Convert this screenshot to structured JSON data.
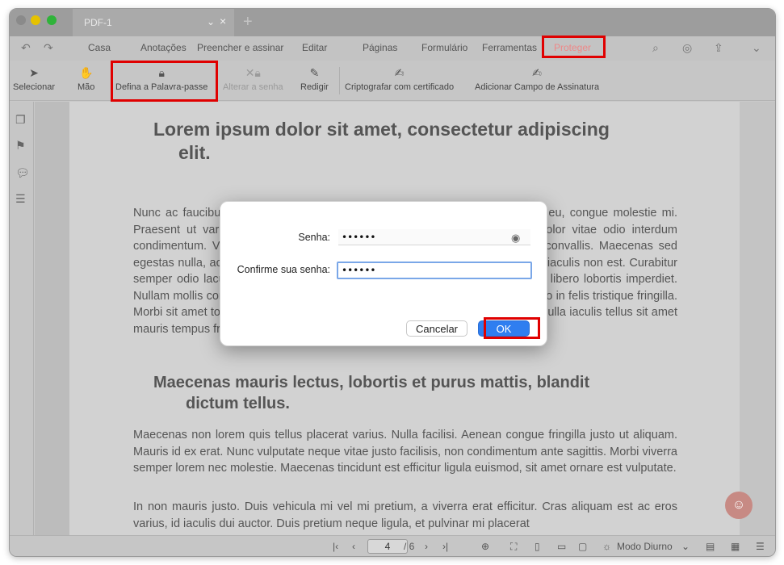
{
  "tab": {
    "title": "PDF-1"
  },
  "menu": {
    "items": [
      "Casa",
      "Anotações",
      "Preencher e assinar",
      "Editar",
      "Páginas",
      "Formulário",
      "Ferramentas",
      "Proteger"
    ]
  },
  "toolbar": {
    "select": "Selecionar",
    "hand": "Mão",
    "set_password": "Defina a Palavra-passe",
    "change_password": "Alterar a senha",
    "redact": "Redigir",
    "encrypt_cert": "Criptografar com certificado",
    "add_signature_field": "Adicionar Campo de Assinatura"
  },
  "document": {
    "heading1_line1": "Lorem ipsum dolor sit amet, consectetur adipiscing",
    "heading1_line2": "elit.",
    "para1": "Nunc ac faucibus odio. Vestibulum neque massa, scelerisque sit amet ligula eu, congue molestie mi. Praesent ut varius sem. Nullam at porttitor arcu, nec lacinia nisi. Ut ac dolor vitae odio interdum condimentum. Vivamus dapibus sodales ex, vitae malesuada ipsum cursus convallis. Maecenas sed egestas nulla, ac condimentum orci. Mauris diam felis, vulputate ac suscipit et, iaculis non est. Curabitur semper odio lacus, vel semper, nec luctus nisl blandit. Integer lacinia ante ac libero lobortis imperdiet. Nullam mollis convallis ipsum, ac accumsan nunc vehicula vitae. Nulla eget justo in felis tristique fringilla. Morbi sit amet tortor quis risus auctor condimentum. Morbi in ullamcorper elit. Nulla iaculis tellus sit amet mauris tempus fringilla.",
    "heading2_line1": "Maecenas mauris lectus, lobortis et purus mattis, blandit",
    "heading2_line2": "dictum tellus.",
    "para2": "Maecenas non lorem quis tellus placerat varius. Nulla facilisi. Aenean congue fringilla justo ut aliquam. Mauris id ex erat. Nunc vulputate neque vitae justo facilisis, non condimentum ante sagittis. Morbi viverra semper lorem nec molestie. Maecenas tincidunt est efficitur ligula euismod, sit amet ornare est vulputate.",
    "para3": "In non mauris justo. Duis vehicula mi vel mi pretium, a viverra erat efficitur. Cras aliquam est ac eros varius, id iaculis dui auctor. Duis pretium neque ligula, et pulvinar mi placerat"
  },
  "dialog": {
    "password_label": "Senha:",
    "password_value": "••••••",
    "confirm_label": "Confirme sua senha:",
    "confirm_value": "••••••",
    "cancel": "Cancelar",
    "ok": "OK"
  },
  "status": {
    "current_page": "4",
    "total_pages": "/ 6",
    "day_mode": "Modo Diurno"
  },
  "colors": {
    "accent": "#2f7ef0",
    "highlight": "#e00000"
  }
}
